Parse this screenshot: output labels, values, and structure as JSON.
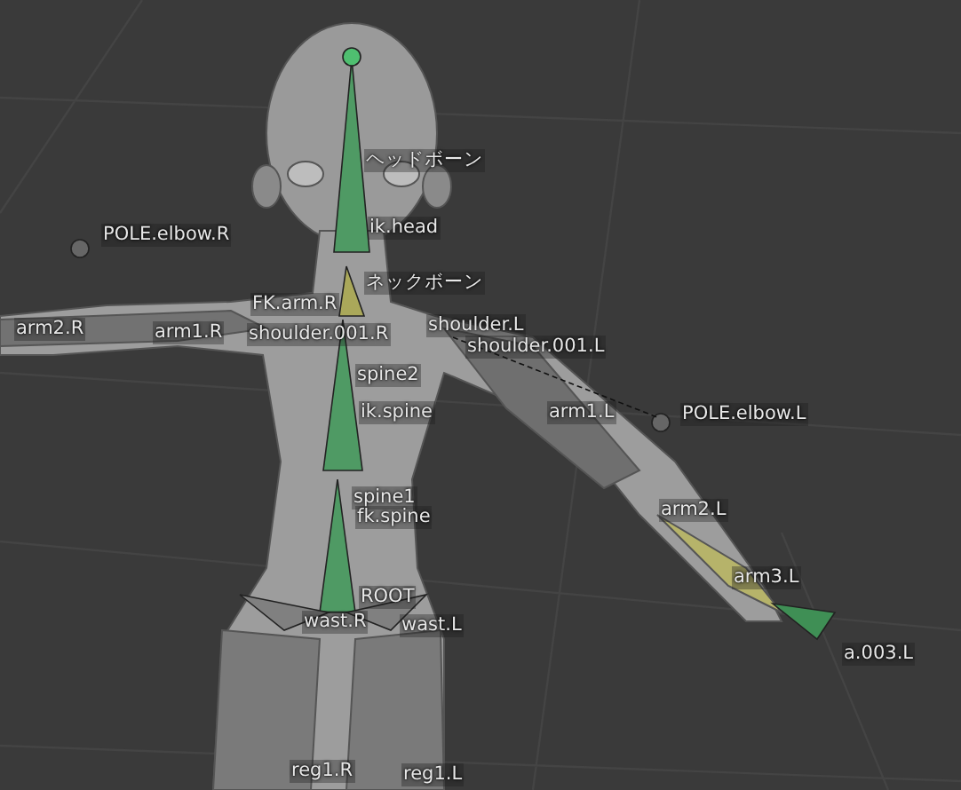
{
  "viewport": {
    "bone_labels": [
      {
        "text": "ヘッドボーン"
      },
      {
        "text": "ik.head"
      },
      {
        "text": "ネックボーン"
      },
      {
        "text": "POLE.elbow.R"
      },
      {
        "text": "arm2.R"
      },
      {
        "text": "arm1.R"
      },
      {
        "text": "FK.arm.R"
      },
      {
        "text": "shoulder.001.R"
      },
      {
        "text": "shoulder.L"
      },
      {
        "text": "shoulder.001.L"
      },
      {
        "text": "spine2"
      },
      {
        "text": "ik.spine"
      },
      {
        "text": "arm1.L"
      },
      {
        "text": "POLE.elbow.L"
      },
      {
        "text": "spine1"
      },
      {
        "text": "fk.spine"
      },
      {
        "text": "arm2.L"
      },
      {
        "text": "arm3.L"
      },
      {
        "text": "ROOT"
      },
      {
        "text": "wast.R"
      },
      {
        "text": "wast.L"
      },
      {
        "text": "reg1.R"
      },
      {
        "text": "reg1.L"
      },
      {
        "text": "a.003.L"
      }
    ]
  }
}
